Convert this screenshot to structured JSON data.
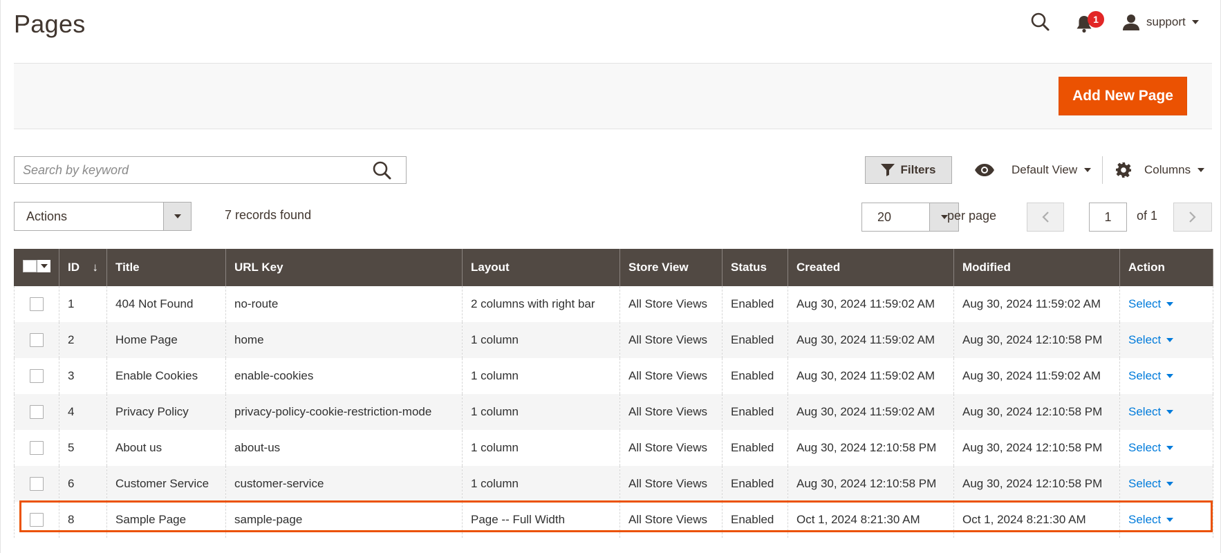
{
  "header": {
    "title": "Pages",
    "notifications_count": "1",
    "user_name": "support"
  },
  "page_actions": {
    "add_new_label": "Add New Page"
  },
  "toolbar": {
    "search_placeholder": "Search by keyword",
    "filters_label": "Filters",
    "view_label": "Default View",
    "columns_label": "Columns",
    "actions_label": "Actions",
    "records_found": "7 records found",
    "per_page_value": "20",
    "per_page_label": "per page",
    "current_page": "1",
    "of_pages": "of 1"
  },
  "grid": {
    "columns": [
      "ID",
      "Title",
      "URL Key",
      "Layout",
      "Store View",
      "Status",
      "Created",
      "Modified",
      "Action"
    ],
    "sort_indicator": "↓",
    "rows": [
      {
        "id": "1",
        "title": "404 Not Found",
        "url_key": "no-route",
        "layout": "2 columns with right bar",
        "store_view": "All Store Views",
        "status": "Enabled",
        "created": "Aug 30, 2024 11:59:02 AM",
        "modified": "Aug 30, 2024 11:59:02 AM",
        "action": "Select"
      },
      {
        "id": "2",
        "title": "Home Page",
        "url_key": "home",
        "layout": "1 column",
        "store_view": "All Store Views",
        "status": "Enabled",
        "created": "Aug 30, 2024 11:59:02 AM",
        "modified": "Aug 30, 2024 12:10:58 PM",
        "action": "Select"
      },
      {
        "id": "3",
        "title": "Enable Cookies",
        "url_key": "enable-cookies",
        "layout": "1 column",
        "store_view": "All Store Views",
        "status": "Enabled",
        "created": "Aug 30, 2024 11:59:02 AM",
        "modified": "Aug 30, 2024 11:59:02 AM",
        "action": "Select"
      },
      {
        "id": "4",
        "title": "Privacy Policy",
        "url_key": "privacy-policy-cookie-restriction-mode",
        "layout": "1 column",
        "store_view": "All Store Views",
        "status": "Enabled",
        "created": "Aug 30, 2024 11:59:02 AM",
        "modified": "Aug 30, 2024 12:10:58 PM",
        "action": "Select"
      },
      {
        "id": "5",
        "title": "About us",
        "url_key": "about-us",
        "layout": "1 column",
        "store_view": "All Store Views",
        "status": "Enabled",
        "created": "Aug 30, 2024 12:10:58 PM",
        "modified": "Aug 30, 2024 12:10:58 PM",
        "action": "Select"
      },
      {
        "id": "6",
        "title": "Customer Service",
        "url_key": "customer-service",
        "layout": "1 column",
        "store_view": "All Store Views",
        "status": "Enabled",
        "created": "Aug 30, 2024 12:10:58 PM",
        "modified": "Aug 30, 2024 12:10:58 PM",
        "action": "Select"
      },
      {
        "id": "8",
        "title": "Sample Page",
        "url_key": "sample-page",
        "layout": "Page -- Full Width",
        "store_view": "All Store Views",
        "status": "Enabled",
        "created": "Oct 1, 2024 8:21:30 AM",
        "modified": "Oct 1, 2024 8:21:30 AM",
        "action": "Select"
      }
    ]
  },
  "colors": {
    "accent": "#eb5202",
    "header_bg": "#514943",
    "link": "#007bdb",
    "badge": "#e22626"
  }
}
